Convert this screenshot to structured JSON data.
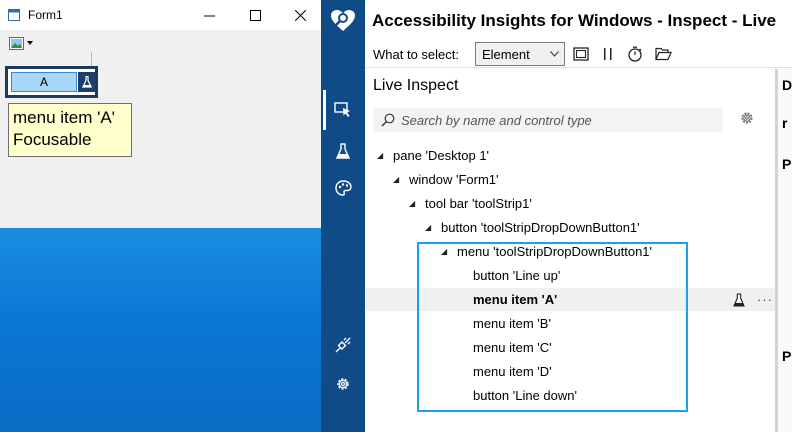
{
  "form": {
    "title": "Form1",
    "menu_item_label": "A",
    "tooltip": {
      "line1": "menu item 'A'",
      "line2": "Focusable"
    }
  },
  "inspector": {
    "app_title": "Accessibility Insights for Windows - Inspect - Live",
    "what_to_select_label": "What to select:",
    "select_value": "Element",
    "pane_title": "Live Inspect",
    "search_placeholder": "Search by name and control type",
    "tree": [
      {
        "label": "pane 'Desktop 1'",
        "indent": 0,
        "expanded": true
      },
      {
        "label": "window 'Form1'",
        "indent": 1,
        "expanded": true
      },
      {
        "label": "tool bar 'toolStrip1'",
        "indent": 2,
        "expanded": true
      },
      {
        "label": "button 'toolStripDropDownButton1'",
        "indent": 3,
        "expanded": true
      },
      {
        "label": "menu 'toolStripDropDownButton1'",
        "indent": 4,
        "expanded": true
      },
      {
        "label": "button 'Line up'",
        "indent": 5,
        "expanded": false
      },
      {
        "label": "menu item 'A'",
        "indent": 5,
        "expanded": false,
        "selected": true
      },
      {
        "label": "menu item 'B'",
        "indent": 5,
        "expanded": false
      },
      {
        "label": "menu item 'C'",
        "indent": 5,
        "expanded": false
      },
      {
        "label": "menu item 'D'",
        "indent": 5,
        "expanded": false
      },
      {
        "label": "button 'Line down'",
        "indent": 5,
        "expanded": false
      }
    ],
    "row_more": "···",
    "details_strip": [
      "D",
      "r",
      "P",
      "P"
    ]
  },
  "colors": {
    "rail": "#0f4b87",
    "accent_box": "#1ea0e6",
    "desktop_blue": "#0a78d4",
    "tooltip_bg": "#ffffcc"
  }
}
